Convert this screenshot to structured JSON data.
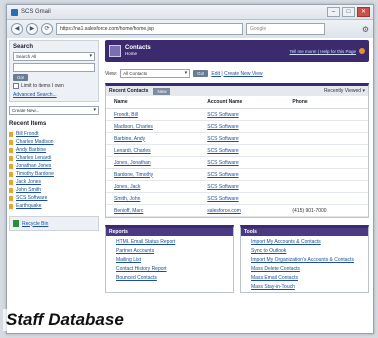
{
  "browser": {
    "tab_title": "SCS Gmail",
    "url": "https://na1.salesforce.com/home/home.jsp",
    "search_placeholder": "Google",
    "back": "◀",
    "forward": "▶",
    "reload": "⟳",
    "tools": "⚙",
    "minimize": "–",
    "maximize": "□",
    "close": "✕"
  },
  "sidebar": {
    "search_title": "Search",
    "search_scope": "Search All",
    "go": "Go!",
    "limit_label": "Limit to items I own",
    "advanced": "Advanced Search...",
    "create_new": "Create New...",
    "recent_title": "Recent Items",
    "recent_items": [
      "Bill Frondt",
      "Charles Madison",
      "Andy Barbine",
      "Charles Lenardi",
      "Jonathan Jones",
      "Timothy Bardone",
      "Jack Jones",
      "John Smith",
      "SCS Software",
      "Earthquake"
    ],
    "recycle": "Recycle Bin"
  },
  "main": {
    "header_line1": "Contacts",
    "header_line2": "Home",
    "help_link": "Tell me more! | Help for this Page",
    "view_label": "View:",
    "view_value": "All Contacts",
    "go": "Go!",
    "view_links": "Edit | Create New View",
    "recent_title": "Recent Contacts",
    "new_button": "New",
    "recently_viewed": "Recently Viewed ▾",
    "columns": [
      "Name",
      "Account Name",
      "Phone"
    ],
    "rows": [
      [
        "Frondt, Bill",
        "SCS Software",
        ""
      ],
      [
        "Madison, Charles",
        "SCS Software",
        ""
      ],
      [
        "Barbine, Andy",
        "SCS Software",
        ""
      ],
      [
        "Lenardi, Charles",
        "SCS Software",
        ""
      ],
      [
        "Jones, Jonathan",
        "SCS Software",
        ""
      ],
      [
        "Bardone, Timothy",
        "SCS Software",
        ""
      ],
      [
        "Jones, Jack",
        "SCS Software",
        ""
      ],
      [
        "Smith, John",
        "SCS Software",
        ""
      ],
      [
        "Benioff, Marc",
        "salesforce.com",
        "(415) 901-7000"
      ]
    ],
    "reports_title": "Reports",
    "reports": [
      "HTML Email Status Report",
      "Partner Accounts",
      "Mailing List",
      "Contact History Report",
      "Bounced Contacts"
    ],
    "tools_title": "Tools",
    "tools": [
      "Import My Accounts & Contacts",
      "Sync to Outlook",
      "Import My Organization's Accounts & Contacts",
      "Mass Delete Contacts",
      "Mass Email Contacts",
      "Mass Stay-in-Touch"
    ]
  },
  "caption": "Staff Database"
}
